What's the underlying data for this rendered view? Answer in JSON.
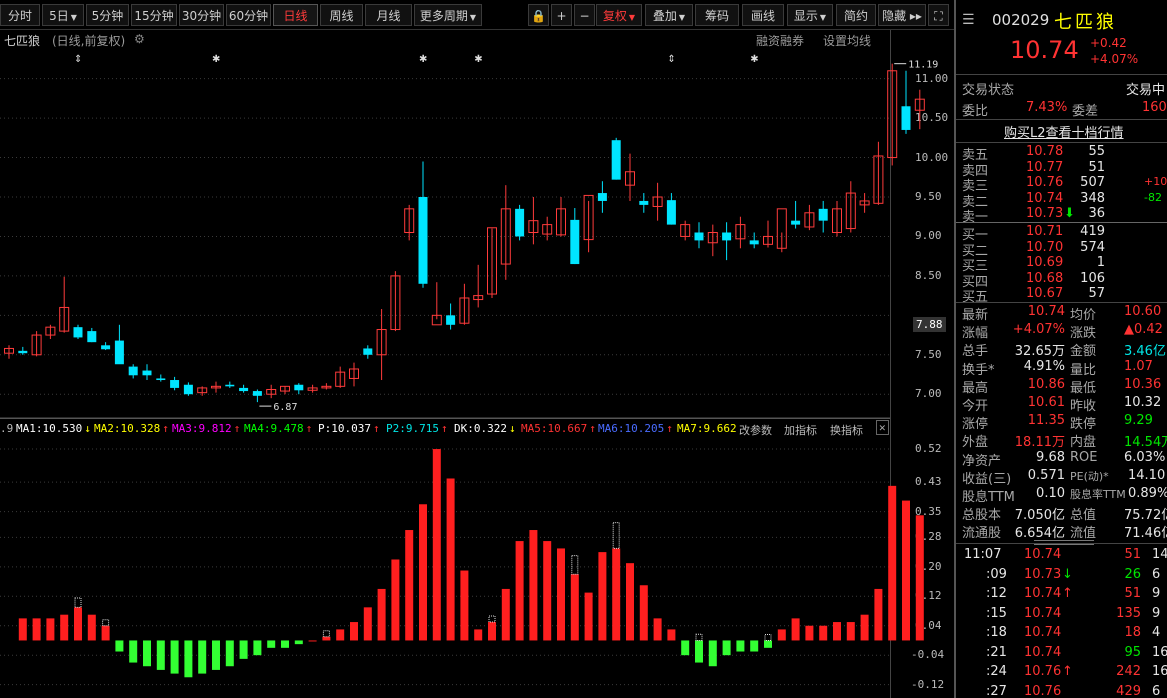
{
  "toolbar": {
    "items": [
      {
        "label": "分时",
        "active": false
      },
      {
        "label": "5日",
        "dropdown": true
      },
      {
        "label": "5分钟"
      },
      {
        "label": "15分钟"
      },
      {
        "label": "30分钟"
      },
      {
        "label": "60分钟"
      },
      {
        "label": "日线",
        "active": true
      },
      {
        "label": "周线"
      },
      {
        "label": "月线"
      },
      {
        "label": "更多周期",
        "dropdown": true
      }
    ],
    "tools": [
      {
        "name": "lock-icon",
        "glyph": "🔒"
      },
      {
        "name": "zoom-in-icon",
        "glyph": "+"
      },
      {
        "name": "zoom-out-icon",
        "glyph": "−"
      },
      {
        "name": "fuquan",
        "label": "复权",
        "dropdown": true
      },
      {
        "name": "overlay",
        "label": "叠加",
        "dropdown": true
      },
      {
        "name": "chips",
        "label": "筹码"
      },
      {
        "name": "draw",
        "label": "画线"
      },
      {
        "name": "display",
        "label": "显示",
        "dropdown": true
      },
      {
        "name": "simple",
        "label": "简约"
      },
      {
        "name": "hide",
        "label": "隐藏 ▸▸"
      }
    ]
  },
  "chart_header": {
    "stock_name": "七匹狼",
    "mode": "(日线,前复权)",
    "margin": "融资融券",
    "ma_setting": "设置均线",
    "max_label": "11.19",
    "min_label": "6.87",
    "current_tag": "7.88"
  },
  "price_axis": [
    "11.00",
    "10.50",
    "10.00",
    "9.50",
    "9.00",
    "8.50",
    "7.50",
    "7.00"
  ],
  "indicator_axis": [
    "0.52",
    "0.43",
    "0.35",
    "0.28",
    "0.20",
    "0.12",
    "0.04",
    "-0.04",
    "-0.12"
  ],
  "indicator_bar": {
    "lead": ".9",
    "items": [
      {
        "text": "MA1:10.530",
        "color": "#ffffff",
        "arrow": "↓"
      },
      {
        "text": "MA2:10.328",
        "color": "#ffff00",
        "arrow": "↑"
      },
      {
        "text": "MA3:9.812",
        "color": "#ff00ff",
        "arrow": "↑"
      },
      {
        "text": "MA4:9.478",
        "color": "#00ff00",
        "arrow": "↑"
      },
      {
        "text": "P:10.037",
        "color": "#ffffff",
        "arrow": "↑"
      },
      {
        "text": "P2:9.715",
        "color": "#00e5e5",
        "arrow": "↑"
      },
      {
        "text": "DK:0.322",
        "color": "#ffffff",
        "arrow": "↓"
      },
      {
        "text": "MA5:10.667",
        "color": "#ff3333",
        "arrow": "↑"
      },
      {
        "text": "MA6:10.205",
        "color": "#4a6cff",
        "arrow": "↑"
      },
      {
        "text": "MA7:9.662",
        "color": "#ffff00",
        "arrow": ""
      }
    ],
    "links": [
      "改参数",
      "加指标",
      "换指标"
    ]
  },
  "chart_data": {
    "type": "candlestick",
    "title": "七匹狼",
    "ylim": [
      6.8,
      11.3
    ],
    "candles": [
      {
        "o": 7.52,
        "h": 7.62,
        "l": 7.45,
        "c": 7.58
      },
      {
        "o": 7.55,
        "h": 7.6,
        "l": 7.5,
        "c": 7.52
      },
      {
        "o": 7.5,
        "h": 7.8,
        "l": 7.48,
        "c": 7.75
      },
      {
        "o": 7.75,
        "h": 7.88,
        "l": 7.7,
        "c": 7.85
      },
      {
        "o": 7.8,
        "h": 8.49,
        "l": 7.78,
        "c": 8.1
      },
      {
        "o": 7.85,
        "h": 7.88,
        "l": 7.7,
        "c": 7.72
      },
      {
        "o": 7.8,
        "h": 7.84,
        "l": 7.66,
        "c": 7.66
      },
      {
        "o": 7.62,
        "h": 7.66,
        "l": 7.56,
        "c": 7.57
      },
      {
        "o": 7.68,
        "h": 7.88,
        "l": 7.42,
        "c": 7.38
      },
      {
        "o": 7.35,
        "h": 7.38,
        "l": 7.2,
        "c": 7.24
      },
      {
        "o": 7.3,
        "h": 7.38,
        "l": 7.18,
        "c": 7.24
      },
      {
        "o": 7.2,
        "h": 7.25,
        "l": 7.16,
        "c": 7.18
      },
      {
        "o": 7.18,
        "h": 7.22,
        "l": 7.05,
        "c": 7.08
      },
      {
        "o": 7.12,
        "h": 7.15,
        "l": 6.98,
        "c": 7.0
      },
      {
        "o": 7.02,
        "h": 7.1,
        "l": 6.98,
        "c": 7.08
      },
      {
        "o": 7.08,
        "h": 7.16,
        "l": 7.02,
        "c": 7.1
      },
      {
        "o": 7.12,
        "h": 7.16,
        "l": 7.08,
        "c": 7.1
      },
      {
        "o": 7.08,
        "h": 7.12,
        "l": 7.02,
        "c": 7.04
      },
      {
        "o": 7.04,
        "h": 7.06,
        "l": 6.9,
        "c": 6.98
      },
      {
        "o": 7.0,
        "h": 7.12,
        "l": 6.95,
        "c": 7.06
      },
      {
        "o": 7.04,
        "h": 7.1,
        "l": 7.0,
        "c": 7.1
      },
      {
        "o": 7.12,
        "h": 7.14,
        "l": 7.0,
        "c": 7.05
      },
      {
        "o": 7.05,
        "h": 7.12,
        "l": 7.02,
        "c": 7.08
      },
      {
        "o": 7.08,
        "h": 7.14,
        "l": 7.06,
        "c": 7.1
      },
      {
        "o": 7.1,
        "h": 7.35,
        "l": 7.08,
        "c": 7.28
      },
      {
        "o": 7.2,
        "h": 7.4,
        "l": 7.1,
        "c": 7.32
      },
      {
        "o": 7.58,
        "h": 7.62,
        "l": 7.45,
        "c": 7.5
      },
      {
        "o": 7.5,
        "h": 8.08,
        "l": 7.18,
        "c": 7.82
      },
      {
        "o": 7.82,
        "h": 8.56,
        "l": 7.8,
        "c": 8.5
      },
      {
        "o": 9.05,
        "h": 9.4,
        "l": 8.95,
        "c": 9.35
      },
      {
        "o": 9.5,
        "h": 9.95,
        "l": 8.35,
        "c": 8.4
      },
      {
        "o": 7.88,
        "h": 8.42,
        "l": 7.95,
        "c": 8.0
      },
      {
        "o": 8.0,
        "h": 8.15,
        "l": 7.82,
        "c": 7.88
      },
      {
        "o": 7.9,
        "h": 8.4,
        "l": 7.88,
        "c": 8.22
      },
      {
        "o": 8.2,
        "h": 8.64,
        "l": 8.1,
        "c": 8.25
      },
      {
        "o": 8.27,
        "h": 9.1,
        "l": 8.22,
        "c": 9.11
      },
      {
        "o": 8.65,
        "h": 9.65,
        "l": 8.45,
        "c": 9.35
      },
      {
        "o": 9.35,
        "h": 9.4,
        "l": 8.95,
        "c": 9.0
      },
      {
        "o": 9.05,
        "h": 9.5,
        "l": 8.9,
        "c": 9.2
      },
      {
        "o": 9.03,
        "h": 9.25,
        "l": 8.95,
        "c": 9.15
      },
      {
        "o": 9.02,
        "h": 9.5,
        "l": 9.0,
        "c": 9.35
      },
      {
        "o": 9.21,
        "h": 9.36,
        "l": 8.65,
        "c": 8.65
      },
      {
        "o": 8.96,
        "h": 9.45,
        "l": 8.8,
        "c": 9.52
      },
      {
        "o": 9.55,
        "h": 9.7,
        "l": 9.3,
        "c": 9.45
      },
      {
        "o": 10.22,
        "h": 10.25,
        "l": 9.72,
        "c": 9.72
      },
      {
        "o": 9.65,
        "h": 10.05,
        "l": 9.45,
        "c": 9.82
      },
      {
        "o": 9.45,
        "h": 9.55,
        "l": 9.3,
        "c": 9.4
      },
      {
        "o": 9.38,
        "h": 9.68,
        "l": 9.2,
        "c": 9.5
      },
      {
        "o": 9.46,
        "h": 9.55,
        "l": 9.15,
        "c": 9.15
      },
      {
        "o": 9.0,
        "h": 9.2,
        "l": 8.95,
        "c": 9.15
      },
      {
        "o": 9.05,
        "h": 9.18,
        "l": 8.85,
        "c": 8.95
      },
      {
        "o": 8.92,
        "h": 9.15,
        "l": 8.75,
        "c": 9.05
      },
      {
        "o": 9.05,
        "h": 9.18,
        "l": 8.7,
        "c": 8.95
      },
      {
        "o": 8.97,
        "h": 9.25,
        "l": 8.85,
        "c": 9.15
      },
      {
        "o": 8.95,
        "h": 9.05,
        "l": 8.85,
        "c": 8.9
      },
      {
        "o": 8.9,
        "h": 9.2,
        "l": 8.86,
        "c": 9.0
      },
      {
        "o": 8.85,
        "h": 9.05,
        "l": 8.8,
        "c": 9.35
      },
      {
        "o": 9.2,
        "h": 9.45,
        "l": 9.1,
        "c": 9.15
      },
      {
        "o": 9.12,
        "h": 9.4,
        "l": 9.08,
        "c": 9.3
      },
      {
        "o": 9.35,
        "h": 9.45,
        "l": 9.05,
        "c": 9.2
      },
      {
        "o": 9.05,
        "h": 9.45,
        "l": 9.0,
        "c": 9.35
      },
      {
        "o": 9.1,
        "h": 9.7,
        "l": 9.05,
        "c": 9.55
      },
      {
        "o": 9.4,
        "h": 9.55,
        "l": 9.3,
        "c": 9.45
      },
      {
        "o": 9.42,
        "h": 10.2,
        "l": 9.4,
        "c": 10.02
      },
      {
        "o": 10.0,
        "h": 11.19,
        "l": 9.9,
        "c": 11.1
      },
      {
        "o": 10.65,
        "h": 11.1,
        "l": 10.3,
        "c": 10.35
      },
      {
        "o": 10.6,
        "h": 10.86,
        "l": 10.36,
        "c": 10.74
      }
    ],
    "dk": [
      0.06,
      0.06,
      0.06,
      0.07,
      0.09,
      0.07,
      0.04,
      -0.03,
      -0.06,
      -0.07,
      -0.08,
      -0.09,
      -0.1,
      -0.09,
      -0.08,
      -0.07,
      -0.05,
      -0.04,
      -0.02,
      -0.02,
      -0.01,
      0.0,
      0.01,
      0.03,
      0.05,
      0.09,
      0.14,
      0.22,
      0.3,
      0.37,
      0.52,
      0.44,
      0.19,
      0.03,
      0.05,
      0.14,
      0.27,
      0.3,
      0.27,
      0.25,
      0.18,
      0.13,
      0.24,
      0.25,
      0.21,
      0.15,
      0.06,
      0.03,
      -0.04,
      -0.06,
      -0.07,
      -0.04,
      -0.03,
      -0.03,
      -0.02,
      0.03,
      0.06,
      0.04,
      0.04,
      0.05,
      0.05,
      0.07,
      0.14,
      0.42,
      0.38,
      0.34
    ],
    "dk_hollow": [
      4,
      6,
      22,
      34,
      40,
      43,
      49,
      54
    ]
  },
  "panel": {
    "code": "002029",
    "name": "七匹狼",
    "price": "10.74",
    "change": "+0.42",
    "change_pct": "+4.07%",
    "status_label": "交易状态",
    "status_value": "交易中",
    "weibi_label": "委比",
    "weibi_value": "7.43%",
    "weicha_label": "委差",
    "weicha_value": "160",
    "l2_link": "购买L2查看十档行情",
    "asks": [
      {
        "label": "卖五",
        "price": "10.78",
        "vol": "55",
        "chg": ""
      },
      {
        "label": "卖四",
        "price": "10.77",
        "vol": "51",
        "chg": ""
      },
      {
        "label": "卖三",
        "price": "10.76",
        "vol": "507",
        "chg": "+10"
      },
      {
        "label": "卖二",
        "price": "10.74",
        "vol": "348",
        "chg": "-82"
      },
      {
        "label": "卖一",
        "price": "10.73",
        "vol": "36",
        "chg": ""
      }
    ],
    "bids": [
      {
        "label": "买一",
        "price": "10.71",
        "vol": "419"
      },
      {
        "label": "买二",
        "price": "10.70",
        "vol": "574"
      },
      {
        "label": "买三",
        "price": "10.69",
        "vol": "1"
      },
      {
        "label": "买四",
        "price": "10.68",
        "vol": "106"
      },
      {
        "label": "买五",
        "price": "10.67",
        "vol": "57"
      }
    ],
    "stats": [
      {
        "l1": "最新",
        "v1": "10.74",
        "c1": "red",
        "l2": "均价",
        "v2": "10.60",
        "c2": "red"
      },
      {
        "l1": "涨幅",
        "v1": "+4.07%",
        "c1": "red",
        "l2": "涨跌",
        "v2": "▲0.42",
        "c2": "red"
      },
      {
        "l1": "总手",
        "v1": "32.65万",
        "c1": "white",
        "l2": "金额",
        "v2": "3.46亿",
        "c2": "cyan"
      },
      {
        "l1": "换手*",
        "v1": "4.91%",
        "c1": "white",
        "l2": "量比",
        "v2": "1.07",
        "c2": "red"
      },
      {
        "l1": "最高",
        "v1": "10.86",
        "c1": "red",
        "l2": "最低",
        "v2": "10.36",
        "c2": "red"
      },
      {
        "l1": "今开",
        "v1": "10.61",
        "c1": "red",
        "l2": "昨收",
        "v2": "10.32",
        "c2": "white"
      },
      {
        "l1": "涨停",
        "v1": "11.35",
        "c1": "red",
        "l2": "跌停",
        "v2": "9.29",
        "c2": "green"
      },
      {
        "l1": "外盘",
        "v1": "18.11万",
        "c1": "red",
        "l2": "内盘",
        "v2": "14.54万",
        "c2": "green"
      },
      {
        "l1": "净资产",
        "v1": "9.68",
        "c1": "white",
        "l2": "ROE",
        "v2": "6.03%",
        "c2": "white"
      },
      {
        "l1": "收益(三)",
        "v1": "0.571",
        "c1": "white",
        "l2": "PE(动)*",
        "v2": "14.10",
        "c2": "white"
      },
      {
        "l1": "股息TTM",
        "v1": "0.10",
        "c1": "white",
        "l2": "股息率TTM",
        "v2": "0.89%",
        "c2": "white"
      },
      {
        "l1": "总股本",
        "v1": "7.050亿",
        "c1": "white",
        "l2": "总值",
        "v2": "75.72亿",
        "c2": "white"
      },
      {
        "l1": "流通股",
        "v1": "6.654亿",
        "c1": "white",
        "l2": "流值",
        "v2": "71.46亿",
        "c2": "white"
      }
    ],
    "trades": [
      {
        "t": "11:07",
        "p": "10.74",
        "arrow": "",
        "v": "51",
        "n": "14",
        "vc": "red"
      },
      {
        "t": ":09",
        "p": "10.73",
        "arrow": "↓",
        "v": "26",
        "n": "6",
        "vc": "green"
      },
      {
        "t": ":12",
        "p": "10.74",
        "arrow": "↑",
        "v": "51",
        "n": "9",
        "vc": "red"
      },
      {
        "t": ":15",
        "p": "10.74",
        "arrow": "",
        "v": "135",
        "n": "9",
        "vc": "red"
      },
      {
        "t": ":18",
        "p": "10.74",
        "arrow": "",
        "v": "18",
        "n": "4",
        "vc": "red"
      },
      {
        "t": ":21",
        "p": "10.74",
        "arrow": "",
        "v": "95",
        "n": "16",
        "vc": "green"
      },
      {
        "t": ":24",
        "p": "10.76",
        "arrow": "↑",
        "v": "242",
        "n": "16",
        "vc": "red"
      },
      {
        "t": ":27",
        "p": "10.76",
        "arrow": "",
        "v": "429",
        "n": "6",
        "vc": "red"
      }
    ]
  }
}
